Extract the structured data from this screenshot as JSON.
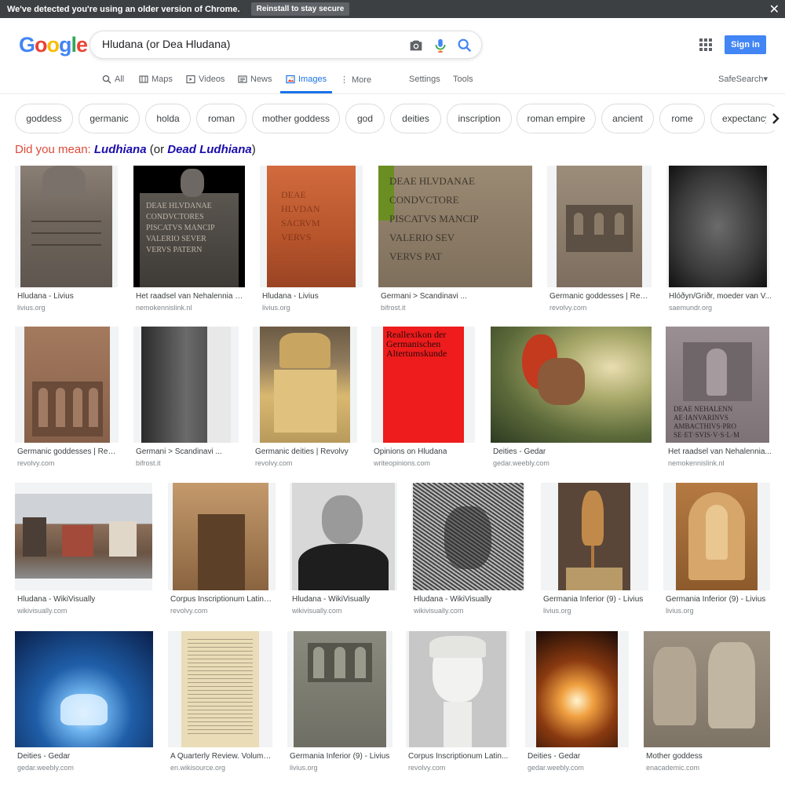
{
  "banner": {
    "message": "We've detected you're using an older version of Chrome.",
    "button_label": "Reinstall to stay secure",
    "close_icon": "close-icon"
  },
  "logo": {
    "letters": [
      "G",
      "o",
      "o",
      "g",
      "l",
      "e"
    ],
    "colors": [
      "#4285f4",
      "#ea4335",
      "#fbbc05",
      "#4285f4",
      "#34a853",
      "#ea4335"
    ]
  },
  "search": {
    "query": "Hludana (or Dea Hludana)",
    "icons": [
      "camera-icon",
      "mic-icon",
      "search-icon"
    ]
  },
  "header": {
    "signin_label": "Sign in",
    "apps_icon": "apps-grid-icon"
  },
  "tabs": {
    "all": "All",
    "maps": "Maps",
    "videos": "Videos",
    "news": "News",
    "images": "Images",
    "more": "More",
    "settings": "Settings",
    "tools": "Tools",
    "safesearch": "SafeSearch"
  },
  "chips": [
    "goddess",
    "germanic",
    "holda",
    "roman",
    "mother goddess",
    "god",
    "deities",
    "inscription",
    "roman empire",
    "ancient",
    "rome",
    "expectancy"
  ],
  "did_you_mean": {
    "prefix": "Did you mean:",
    "sugg1": "Ludhiana",
    "mid": "(or",
    "sugg2": "Dead Ludhiana",
    "suffix": ")"
  },
  "results": [
    {
      "title": "Hludana - Livius",
      "site": "livius.org"
    },
    {
      "title": "Het raadsel van Nehalennia o...",
      "site": "nemokennislink.nl"
    },
    {
      "title": "Hludana - Livius",
      "site": "livius.org"
    },
    {
      "title": "Germani > Scandinavi ...",
      "site": "bifrost.it"
    },
    {
      "title": "Germanic goddesses | Revo...",
      "site": "revolvy.com"
    },
    {
      "title": "Hlóðyn/Griðr, moeder van V...",
      "site": "saemundr.org"
    },
    {
      "title": "Germanic goddesses | Revo...",
      "site": "revolvy.com"
    },
    {
      "title": "Germani > Scandinavi ...",
      "site": "bifrost.it"
    },
    {
      "title": "Germanic deities | Revolvy",
      "site": "revolvy.com"
    },
    {
      "title": "Opinions on Hludana",
      "site": "writeopinions.com"
    },
    {
      "title": "Deities - Gedar",
      "site": "gedar.weebly.com"
    },
    {
      "title": "Het raadsel van Nehalennia...",
      "site": "nemokennislink.nl"
    },
    {
      "title": "Hludana - WikiVisually",
      "site": "wikivisually.com"
    },
    {
      "title": "Corpus Inscriptionum Latina...",
      "site": "revolvy.com"
    },
    {
      "title": "Hludana - WikiVisually",
      "site": "wikivisually.com"
    },
    {
      "title": "Hludana - WikiVisually",
      "site": "wikivisually.com"
    },
    {
      "title": "Germania Inferior (9) - Livius",
      "site": "livius.org"
    },
    {
      "title": "Germania Inferior (9) - Livius",
      "site": "livius.org"
    },
    {
      "title": "Deities - Gedar",
      "site": "gedar.weebly.com"
    },
    {
      "title": "A Quarterly Review. Volume...",
      "site": "en.wikisource.org"
    },
    {
      "title": "Germania Inferior (9) - Livius",
      "site": "livius.org"
    },
    {
      "title": "Corpus Inscriptionum Latin...",
      "site": "revolvy.com"
    },
    {
      "title": "Deities - Gedar",
      "site": "gedar.weebly.com"
    },
    {
      "title": "Mother goddess",
      "site": "enacademic.com"
    }
  ],
  "inscriptions": {
    "r1c2": [
      "DEAE HLVDANAE",
      "CONDVCTORES",
      "PISCATVS MANCIP",
      "VALERIO SEVER",
      "VERVS PATERN"
    ],
    "r1c3": [
      "DEAE",
      "HLVDAN",
      "SACRVM",
      "VERVS"
    ],
    "r1c4": [
      "DEAE HLVDANAE",
      "CONDVCTORE",
      "PISCATVS MANCIP",
      "VALERIO SEV",
      "VERVS PAT"
    ],
    "book": [
      "Reallexikon der",
      "Germanischen",
      "Altertumskunde"
    ],
    "nehalennia": [
      "DEAE NEHALENN",
      "AE·IANVARINVS",
      "AMBACTHIVS·PRO",
      "SE·ET·SVIS·V·S·L·M"
    ]
  }
}
